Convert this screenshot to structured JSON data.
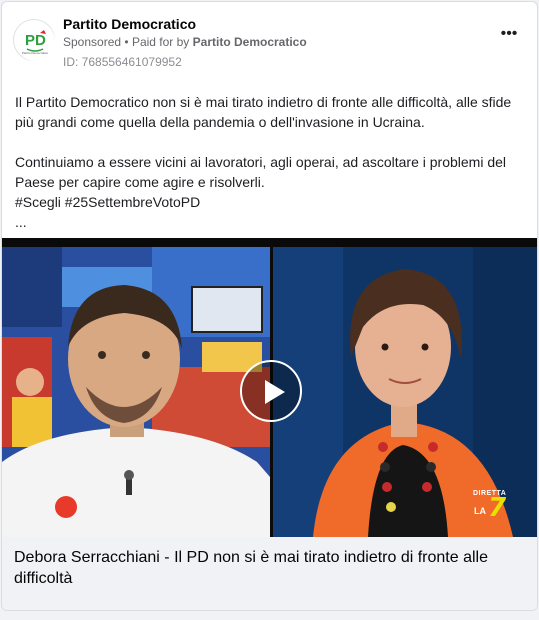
{
  "post": {
    "page_name": "Partito Democratico",
    "sponsored_label": "Sponsored",
    "separator": "•",
    "paid_for_prefix": "Paid for by",
    "paid_for_by": "Partito Democratico",
    "ad_id": "ID: 768556461079952",
    "more_icon_text": "•••",
    "body_paragraph_1": "Il Partito Democratico non si è mai tirato indietro di fronte alle difficoltà, alle sfide più grandi come quella della pandemia o dell'invasione in Ucraina.",
    "body_paragraph_2_line_1": "Continuiamo a essere vicini ai lavoratori, agli operai, ad ascoltare i problemi del Paese per capire come agire e risolverli.",
    "hashtags": "#Scegli #25SettembreVotoPD",
    "ellipsis": "...",
    "avatar_logo_text": "PD",
    "avatar_logo_subtext": "Partito Democratico"
  },
  "media": {
    "type": "video",
    "channel_overlay_top": "DIRETTA",
    "channel_overlay_la": "LA",
    "channel_overlay_number": "7",
    "play_icon": "play-icon"
  },
  "caption": {
    "title": "Debora Serracchiani - Il PD non si è mai tirato indietro di fronte alle difficoltà"
  },
  "colors": {
    "pd_green": "#2e9e3e",
    "pd_red": "#d92b2b",
    "secondary_text": "#65676b",
    "caption_bg": "#f0f2f5"
  }
}
